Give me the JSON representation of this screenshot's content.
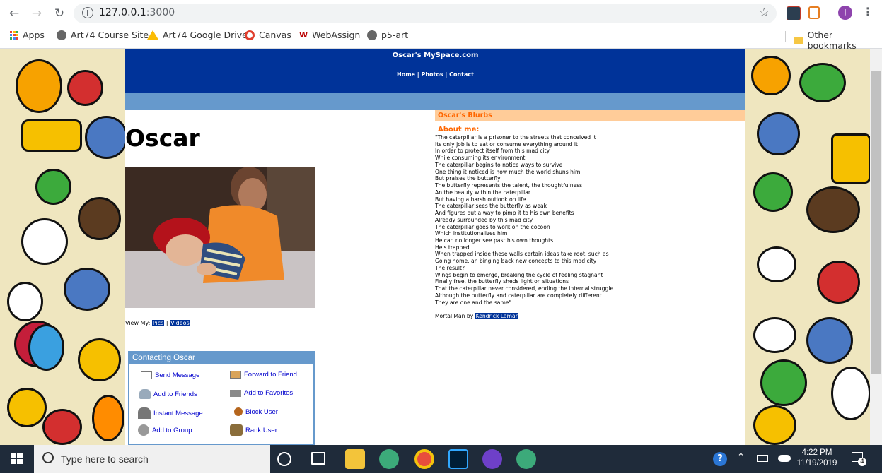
{
  "browser": {
    "url_host": "127.0.0.1",
    "url_port": ":3000",
    "profile_initial": "J",
    "bookmarks": [
      "Apps",
      "Art74 Course Site",
      "Art74 Google Drive",
      "Canvas",
      "WebAssign",
      "p5-art"
    ],
    "other_bookmarks": "Other bookmarks"
  },
  "site": {
    "title": "Oscar's MySpace.com",
    "nav_links": "Home | Photos | Contact"
  },
  "profile": {
    "name": "Oscar",
    "view_my_label": "View My:",
    "view_my_sep": "|",
    "view_links": [
      "Pics",
      "Videos"
    ]
  },
  "contact": {
    "heading": "Contacting Oscar",
    "items": [
      "Send Message",
      "Forward to Friend",
      "Add to Friends",
      "Add to Favorites",
      "Instant Message",
      "Block User",
      "Add to Group",
      "Rank User"
    ]
  },
  "blurbs": {
    "heading": "Oscar's Blurbs",
    "about_label": "About me:",
    "poem": [
      "\"The caterpillar is a prisoner to the streets that conceived it",
      "Its only job is to eat or consume everything around it",
      "In order to protect itself from this mad city",
      "While consuming its environment",
      "The caterpillar begins to notice ways to survive",
      "One thing it noticed is how much the world shuns him",
      "But praises the butterfly",
      "The butterfly represents the talent, the thoughtfulness",
      "An the beauty within the caterpillar",
      "But having a harsh outlook on life",
      "The caterpillar sees the butterfly as weak",
      "And figures out a way to pimp it to his own benefits",
      "Already surrounded by this mad city",
      "The caterpillar goes to work on the cocoon",
      "Which institutionalizes him",
      "He can no longer see past his own thoughts",
      "He's trapped",
      "When trapped inside these walls certain ideas take root, such as",
      "Going home, an binging back new concepts to this mad city",
      "The result?",
      "Wings begin to emerge, breaking the cycle of feeling stagnant",
      "Finally free, the butterfly sheds light on situations",
      "That the caterpillar never considered, ending the internal struggle",
      "Although the butterfly and caterpillar are completely different",
      "They are one and the same\""
    ],
    "credit_prefix": "Mortal Man by",
    "credit_link": "Kendrick Lamar"
  },
  "taskbar": {
    "search_placeholder": "Type here to search",
    "time": "4:22 PM",
    "date": "11/19/2019",
    "notification_count": "4"
  }
}
